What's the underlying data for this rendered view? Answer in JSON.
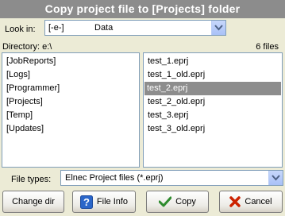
{
  "window": {
    "title": "Copy project file to [Projects] folder"
  },
  "lookin": {
    "label": "Look in:",
    "drive": "[-e-]",
    "folder": "Data"
  },
  "directory": {
    "label": "Directory: e:\\",
    "count": "6 files"
  },
  "folders": [
    "[JobReports]",
    "[Logs]",
    "[Programmer]",
    "[Projects]",
    "[Temp]",
    "[Updates]"
  ],
  "files": [
    "test_1.eprj",
    "test_1_old.eprj",
    "test_2.eprj",
    "test_2_old.eprj",
    "test_3.eprj",
    "test_3_old.eprj"
  ],
  "selected_file_index": 2,
  "filetypes": {
    "label": "File types:",
    "value": "Elnec Project files (*.eprj)"
  },
  "buttons": {
    "change_dir": "Change dir",
    "file_info": "File Info",
    "copy": "Copy",
    "cancel": "Cancel"
  },
  "colors": {
    "titlebar": "#8c8c8c",
    "selection": "#8d8d8d",
    "dialog_bg": "#ecebd6",
    "copy_check": "#2e8b2e",
    "cancel_x": "#cc2200",
    "info_blue": "#2b66c9"
  }
}
